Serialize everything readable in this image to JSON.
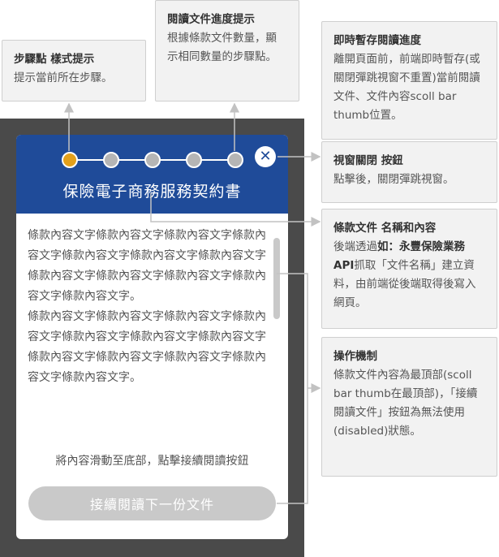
{
  "modal": {
    "title": "保險電子商務服務契約書",
    "close_symbol": "✕",
    "steps": [
      {
        "state": "active"
      },
      {
        "state": "inactive"
      },
      {
        "state": "inactive"
      },
      {
        "state": "inactive"
      },
      {
        "state": "inactive"
      }
    ],
    "paragraphs": [
      "條款內容文字條款內容文字條款內容文字條款內容文字條款內容文字條款內容文字條款內容文字條款內容文字條款內容文字條款內容文字條款內容文字條款內容文字。",
      "條款內容文字條款內容文字條款內容文字條款內容文字條款內容文字條款內容文字條款內容文字條款內容文字條款內容文字條款內容文字條款內容文字條款內容文字。"
    ],
    "hint": "將內容滑動至底部，點擊接續閱讀按鈕",
    "next_button": "接續閱讀下一份文件",
    "next_button_state": "disabled"
  },
  "annotations": {
    "step_dots": {
      "title": "步驟點 樣式提示",
      "body": "提示當前所在步驟。"
    },
    "progress": {
      "title": "閱讀文件進度提示",
      "body": "根據條款文件數量，顯示相同數量的步驟點。"
    },
    "save": {
      "title": "即時暫存閱讀進度",
      "body": "離開頁面前，前端即時暫存(或關閉彈跳視窗不重置)當前閱讀文件、文件內容scoll bar thumb位置。"
    },
    "close": {
      "title": "視窗關閉 按鈕",
      "body": "點擊後，關閉彈跳視窗。"
    },
    "doc": {
      "title": "條款文件 名稱和內容",
      "body_prefix": "後端透過",
      "body_bold": "如：永豐保險業務API",
      "body_suffix": "抓取「文件名稱」建立資料，由前端從後端取得後寫入網頁。"
    },
    "mechanism": {
      "title": "操作機制",
      "body": "條款文件內容為最頂部(scoll bar thumb在最頂部)，「接續閱讀文件」按鈕為無法使用(disabled)狀態。"
    }
  }
}
